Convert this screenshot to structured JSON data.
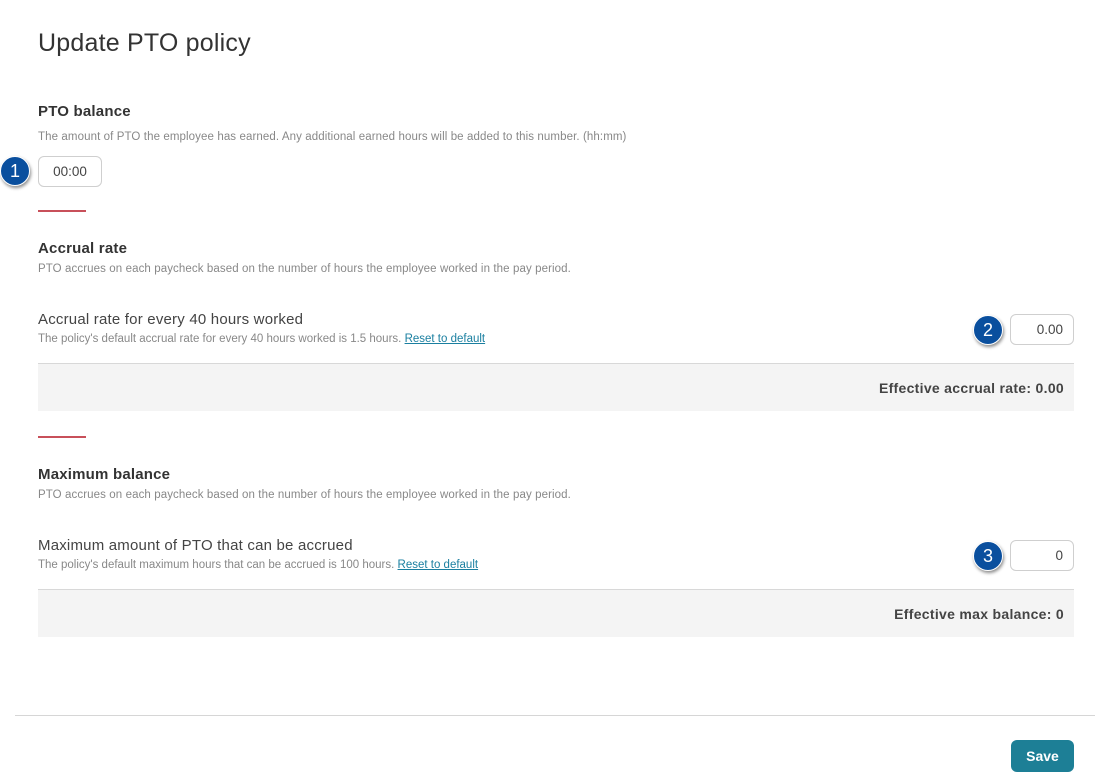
{
  "page": {
    "title": "Update PTO policy"
  },
  "pto_balance": {
    "heading": "PTO balance",
    "description": "The amount of PTO the employee has earned. Any additional earned hours will be added to this number. (hh:mm)",
    "value": "00:00",
    "callout": "1"
  },
  "accrual_rate": {
    "heading": "Accrual rate",
    "description": "PTO accrues on each paycheck based on the number of hours the employee worked in the pay period.",
    "setting_label": "Accrual rate for every 40 hours worked",
    "setting_help": "The policy's default accrual rate for every 40 hours worked is 1.5 hours.",
    "reset_link": "Reset to default",
    "value": "0.00",
    "effective_text": "Effective accrual rate: 0.00",
    "callout": "2"
  },
  "maximum_balance": {
    "heading": "Maximum balance",
    "description": "PTO accrues on each paycheck based on the number of hours the employee worked in the pay period.",
    "setting_label": "Maximum amount of PTO that can be accrued",
    "setting_help": "The policy's default maximum hours that can be accrued is 100 hours.",
    "reset_link": "Reset to default",
    "value": "0",
    "effective_text": "Effective max balance: 0",
    "callout": "3"
  },
  "footer": {
    "save_label": "Save"
  },
  "colors": {
    "accent_divider": "#c8505a",
    "save_button": "#1d7f96",
    "callout_fill": "#0a4f9e",
    "link": "#1a7fa0"
  }
}
